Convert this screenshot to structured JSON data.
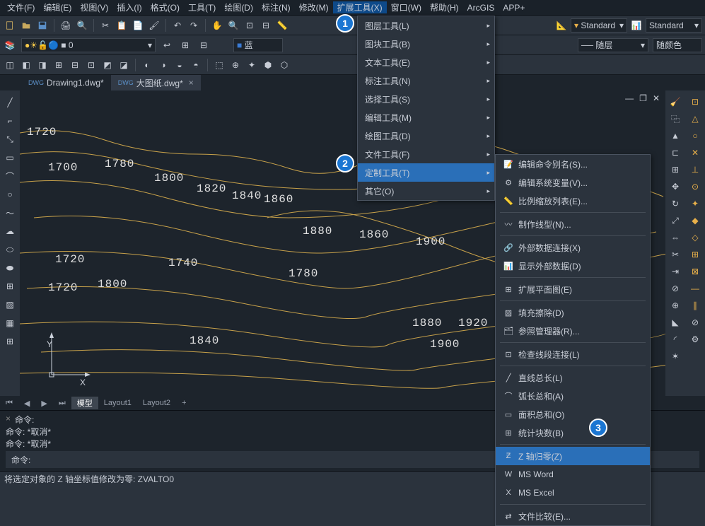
{
  "menubar": {
    "items": [
      "文件(F)",
      "编辑(E)",
      "视图(V)",
      "插入(I)",
      "格式(O)",
      "工具(T)",
      "绘图(D)",
      "标注(N)",
      "修改(M)",
      "扩展工具(X)",
      "窗口(W)",
      "帮助(H)",
      "ArcGIS",
      "APP+"
    ]
  },
  "toolbar1": {
    "style_combo1": "Standard",
    "style_combo2": "Standard"
  },
  "toolbar2": {
    "layer": "0",
    "color_label": "蓝",
    "lineweight": "随层",
    "color_filter": "随颜色"
  },
  "tabs": {
    "items": [
      {
        "icon": "dwg",
        "label": "Drawing1.dwg*"
      },
      {
        "icon": "dwg",
        "label": "大图纸.dwg*"
      }
    ]
  },
  "dropdown1": {
    "items": [
      "图层工具(L)",
      "图块工具(B)",
      "文本工具(E)",
      "标注工具(N)",
      "选择工具(S)",
      "编辑工具(M)",
      "绘图工具(D)",
      "文件工具(F)",
      "定制工具(T)",
      "其它(O)"
    ]
  },
  "dropdown2": {
    "items": [
      "编辑命令别名(S)...",
      "编辑系统变量(V)...",
      "比例缩放列表(E)...",
      "制作线型(N)...",
      "外部数据连接(X)",
      "显示外部数据(D)",
      "扩展平面图(E)",
      "填充擦除(D)",
      "参照管理器(R)...",
      "检查线段连接(L)",
      "直线总长(L)",
      "弧长总和(A)",
      "面积总和(O)",
      "统计块数(B)",
      "Z 轴归零(Z)",
      "MS Word",
      "MS Excel",
      "文件比较(E)..."
    ]
  },
  "layout_tabs": {
    "items": [
      "模型",
      "Layout1",
      "Layout2",
      "+"
    ]
  },
  "command": {
    "lines": [
      "命令:",
      "命令: *取消*",
      "命令: *取消*"
    ],
    "prompt": "命令:"
  },
  "statusbar": {
    "text": "将选定对象的 Z 轴坐标值修改为零: ZVALTO0"
  },
  "markers": {
    "m1": "1",
    "m2": "2",
    "m3": "3"
  },
  "contours": {
    "labels": [
      "1720",
      "1700",
      "1780",
      "1800",
      "1820",
      "1840",
      "1860",
      "1880",
      "1860",
      "1900",
      "1720",
      "1740",
      "1780",
      "1720",
      "1800",
      "1840",
      "1880",
      "1920",
      "1900"
    ]
  },
  "axis": {
    "x": "X",
    "y": "Y"
  }
}
